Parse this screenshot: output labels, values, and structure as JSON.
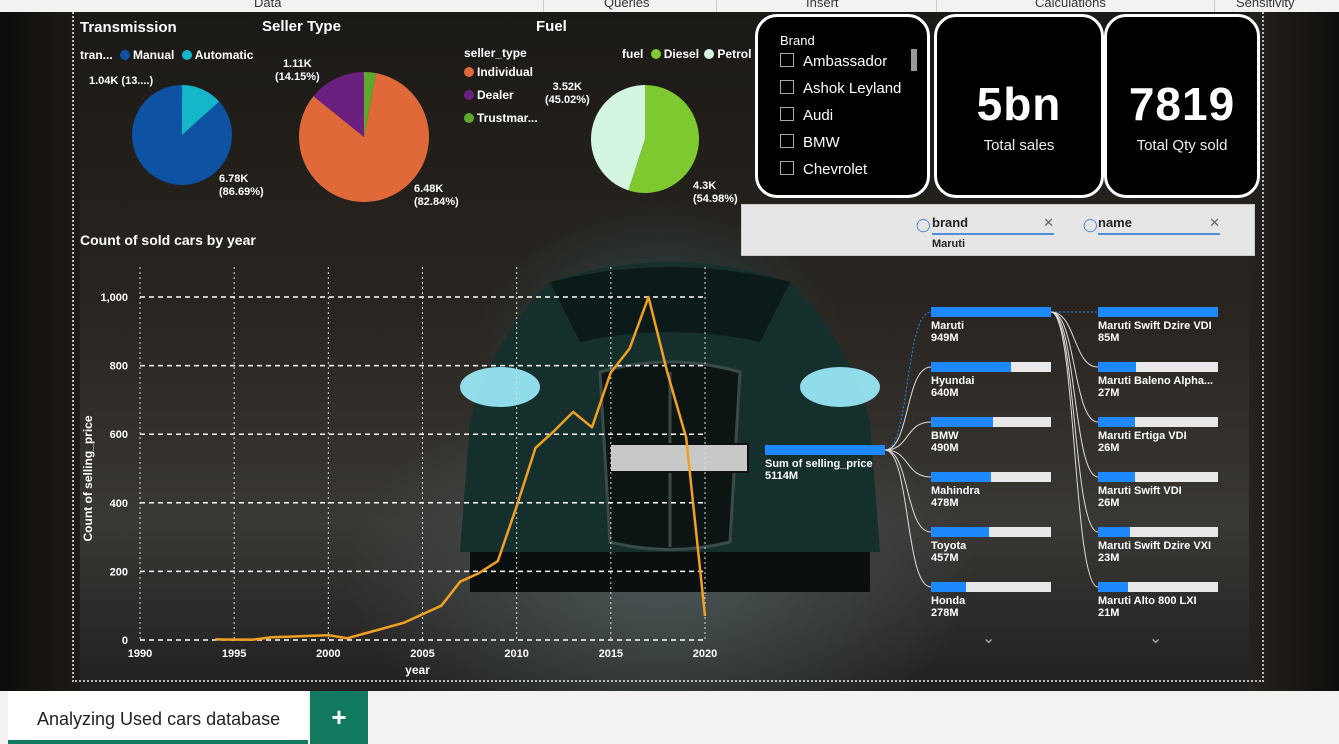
{
  "ribbon": {
    "items": [
      {
        "label": "Data"
      },
      {
        "label": "Queries"
      },
      {
        "label": "Insert"
      },
      {
        "label": "Calculations"
      },
      {
        "label": "Sensitivity"
      }
    ]
  },
  "transmission": {
    "title": "Transmission",
    "legend_title": "tran...",
    "legend": [
      {
        "name": "Manual",
        "color": "#0d52a3"
      },
      {
        "name": "Automatic",
        "color": "#14b6c9"
      }
    ],
    "label_small": "1.04K (13....)",
    "label_big_value": "6.78K",
    "label_big_pct": "(86.69%)",
    "slices": [
      {
        "name": "Manual",
        "value": 86.69
      },
      {
        "name": "Automatic",
        "value": 13.31
      }
    ]
  },
  "seller": {
    "title": "Seller Type",
    "legend_title": "seller_type",
    "legend": [
      {
        "name": "Individual",
        "color": "#e0693a"
      },
      {
        "name": "Dealer",
        "color": "#6b2080"
      },
      {
        "name": "Trustmar...",
        "color": "#5fa82e"
      }
    ],
    "label_small_value": "1.11K",
    "label_small_pct": "(14.15%)",
    "label_big_value": "6.48K",
    "label_big_pct": "(82.84%)",
    "slices": [
      {
        "name": "Individual",
        "value": 82.84
      },
      {
        "name": "Dealer",
        "value": 14.15
      },
      {
        "name": "Trustmark",
        "value": 3.01
      }
    ]
  },
  "fuel": {
    "title": "Fuel",
    "legend_title": "fuel",
    "legend": [
      {
        "name": "Diesel",
        "color": "#7ec92f"
      },
      {
        "name": "Petrol",
        "color": "#d4f5e0"
      }
    ],
    "label_a_value": "3.52K",
    "label_a_pct": "(45.02%)",
    "label_b_value": "4.3K",
    "label_b_pct": "(54.98%)",
    "slices": [
      {
        "name": "Diesel",
        "value": 54.98
      },
      {
        "name": "Petrol",
        "value": 45.02
      }
    ]
  },
  "brand_slicer": {
    "title": "Brand",
    "items": [
      {
        "label": "Ambassador"
      },
      {
        "label": "Ashok Leyland"
      },
      {
        "label": "Audi"
      },
      {
        "label": "BMW"
      },
      {
        "label": "Chevrolet"
      }
    ]
  },
  "cards": [
    {
      "value": "5bn",
      "caption": "Total sales"
    },
    {
      "value": "7819",
      "caption": "Total Qty sold"
    }
  ],
  "filters": [
    {
      "field": "brand",
      "value": "Maruti"
    },
    {
      "field": "name"
    }
  ],
  "line_chart": {
    "title": "Count of sold cars by year"
  },
  "chart_data": {
    "type": "line",
    "xlabel": "year",
    "ylabel": "Count of selling_price",
    "xlim": [
      1990,
      2020
    ],
    "ylim": [
      0,
      1000
    ],
    "x_ticks": [
      1990,
      1995,
      2000,
      2005,
      2010,
      2015,
      2020
    ],
    "y_ticks": [
      0,
      200,
      400,
      600,
      800,
      1000
    ],
    "y_tick_labels": [
      "0",
      "200",
      "400",
      "600",
      "800",
      "1,000"
    ],
    "grid": true,
    "color": "#f2a023",
    "x": [
      1994,
      1995,
      1996,
      1997,
      1998,
      1999,
      2000,
      2001,
      2002,
      2003,
      2004,
      2005,
      2006,
      2007,
      2008,
      2009,
      2010,
      2011,
      2012,
      2013,
      2014,
      2015,
      2016,
      2017,
      2018,
      2019,
      2020
    ],
    "y": [
      2,
      1,
      1,
      8,
      10,
      12,
      14,
      5,
      20,
      35,
      50,
      75,
      100,
      170,
      195,
      230,
      390,
      560,
      610,
      665,
      620,
      780,
      850,
      1000,
      780,
      590,
      70
    ]
  },
  "tree": {
    "root": {
      "name": "Sum of selling_price",
      "value": "5114M"
    },
    "level1": [
      {
        "name": "Maruti",
        "value": "949M",
        "fraction": 1.0
      },
      {
        "name": "Hyundai",
        "value": "640M",
        "fraction": 0.67
      },
      {
        "name": "BMW",
        "value": "490M",
        "fraction": 0.52
      },
      {
        "name": "Mahindra",
        "value": "478M",
        "fraction": 0.5
      },
      {
        "name": "Toyota",
        "value": "457M",
        "fraction": 0.48
      },
      {
        "name": "Honda",
        "value": "278M",
        "fraction": 0.29
      }
    ],
    "level2": [
      {
        "name": "Maruti Swift Dzire VDI",
        "value": "85M",
        "fraction": 1.0
      },
      {
        "name": "Maruti Baleno Alpha...",
        "value": "27M",
        "fraction": 0.32
      },
      {
        "name": "Maruti Ertiga VDI",
        "value": "26M",
        "fraction": 0.31
      },
      {
        "name": "Maruti Swift VDI",
        "value": "26M",
        "fraction": 0.31
      },
      {
        "name": "Maruti Swift Dzire VXI",
        "value": "23M",
        "fraction": 0.27
      },
      {
        "name": "Maruti Alto 800 LXI",
        "value": "21M",
        "fraction": 0.25
      }
    ]
  },
  "tabs": {
    "active": "Analyzing Used cars database",
    "add": "+"
  }
}
